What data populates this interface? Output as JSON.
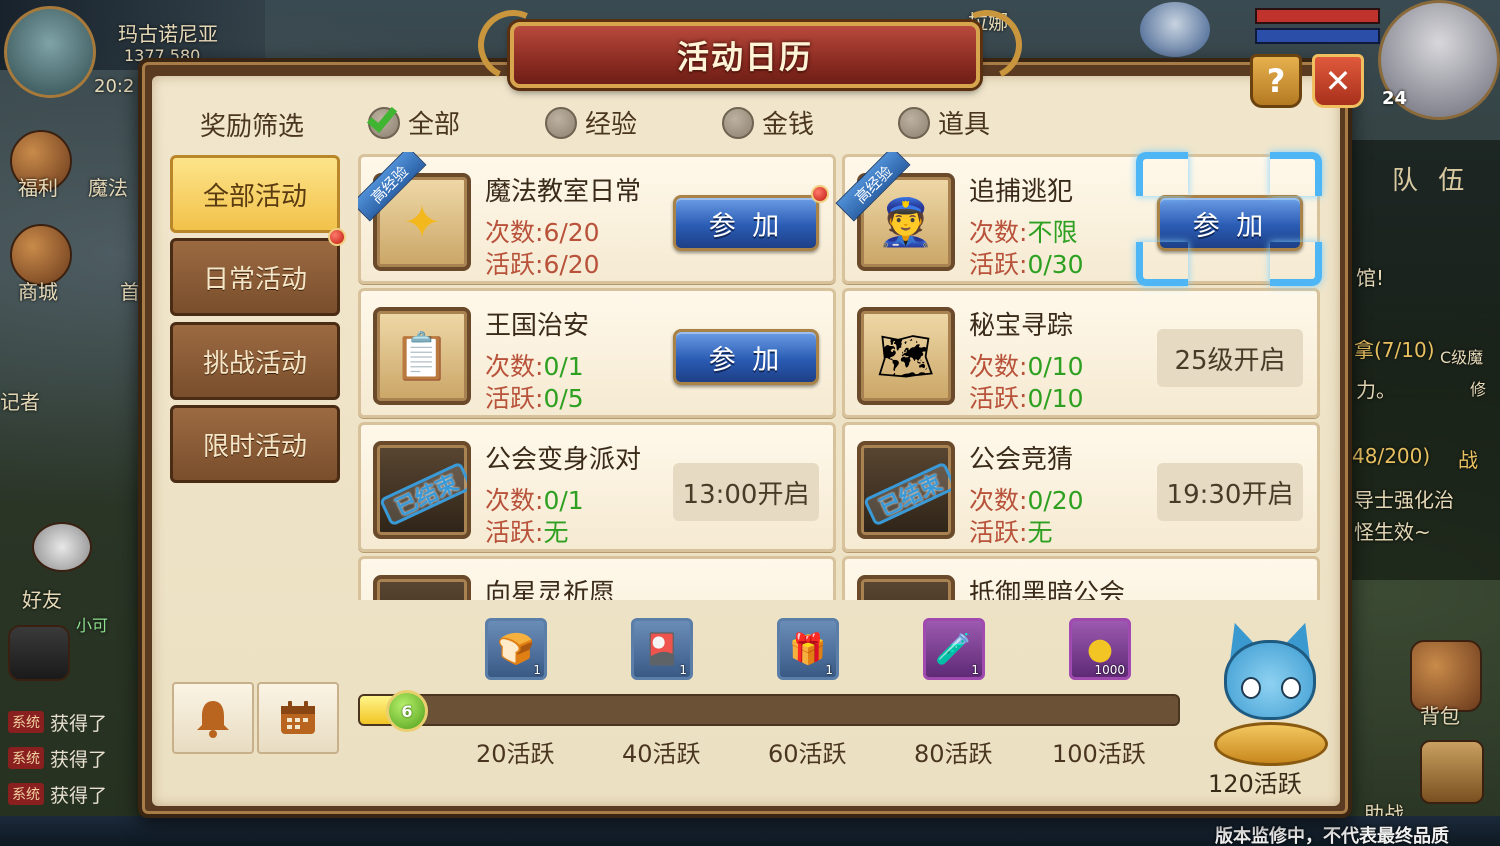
{
  "background": {
    "location_name": "玛古诺尼亚",
    "coords_partial": "1377,580",
    "time_partial": "20:2",
    "side_labels": [
      "福利",
      "魔法",
      "商城",
      "首",
      "记者",
      "好友",
      "小可"
    ],
    "npc_name": "拉娜",
    "player_level": "24",
    "team_label": "队 伍",
    "right_texts": [
      "馆!",
      "拿(7/10)",
      "C级魔",
      "力。",
      "修",
      "48/200)",
      "战",
      "导士强化治",
      "怪生效~"
    ],
    "bag_label": "背包",
    "fight_label": "助战",
    "chat": [
      {
        "badge": "系统",
        "text": "获得了"
      },
      {
        "badge": "系统",
        "text": "获得了"
      },
      {
        "badge": "系统",
        "text": "获得了"
      }
    ],
    "watermark": "版本监修中，不代表最终品质"
  },
  "dialog": {
    "title": "活动日历",
    "help_icon": "question-mark-icon",
    "close_icon": "close-x-icon"
  },
  "filter": {
    "label": "奖励筛选",
    "options": [
      {
        "label": "全部",
        "checked": true
      },
      {
        "label": "经验",
        "checked": false
      },
      {
        "label": "金钱",
        "checked": false
      },
      {
        "label": "道具",
        "checked": false
      }
    ]
  },
  "tabs": [
    {
      "label": "全部活动",
      "active": true,
      "dot": false
    },
    {
      "label": "日常活动",
      "active": false,
      "dot": true
    },
    {
      "label": "挑战活动",
      "active": false,
      "dot": false
    },
    {
      "label": "限时活动",
      "active": false,
      "dot": false
    }
  ],
  "activities": [
    {
      "name": "魔法教室日常",
      "ribbon": "高经验",
      "count_label": "次数:",
      "count": "6/20",
      "active_label": "活跃:",
      "active": "6/20",
      "action": "参 加",
      "icon": "magic-hand-icon",
      "dot": true
    },
    {
      "name": "追捕逃犯",
      "ribbon": "高经验",
      "count_label": "次数:",
      "count": "不限",
      "active_label": "活跃:",
      "active": "0/30",
      "action": "参 加",
      "icon": "wanted-poster-icon",
      "dot": false
    },
    {
      "name": "王国治安",
      "ribbon": "",
      "count_label": "次数:",
      "count": "0/1",
      "active_label": "活跃:",
      "active": "0/5",
      "action": "参 加",
      "icon": "notice-board-icon",
      "dot": false
    },
    {
      "name": "秘宝寻踪",
      "ribbon": "",
      "count_label": "次数:",
      "count": "0/10",
      "active_label": "活跃:",
      "active": "0/10",
      "status": "25级开启",
      "icon": "treasure-map-icon",
      "dot": false
    },
    {
      "name": "公会变身派对",
      "ribbon": "",
      "count_label": "次数:",
      "count": "0/1",
      "active_label": "活跃:",
      "active": "无",
      "status": "13:00开启",
      "stamp": "已结束",
      "icon": "guild-party-icon",
      "dot": false
    },
    {
      "name": "公会竞猜",
      "ribbon": "",
      "count_label": "次数:",
      "count": "0/20",
      "active_label": "活跃:",
      "active": "无",
      "status": "19:30开启",
      "stamp": "已结束",
      "icon": "guild-guess-icon",
      "dot": false
    },
    {
      "name": "向星灵祈愿",
      "ribbon": "",
      "count_label": "",
      "count": "",
      "active_label": "",
      "active": "",
      "icon": "star-spirit-icon",
      "dot": false
    },
    {
      "name": "抵御黑暗公会",
      "ribbon": "",
      "count_label": "",
      "count": "",
      "active_label": "",
      "active": "",
      "icon": "dark-guild-icon",
      "dot": false
    }
  ],
  "bottom_buttons": {
    "bell_icon": "bell-icon",
    "calendar_icon": "calendar-icon"
  },
  "rewards": [
    {
      "tier": "20活跃",
      "icon": "bread-icon",
      "count": "1",
      "rarity": "blue"
    },
    {
      "tier": "40活跃",
      "icon": "red-card-icon",
      "count": "1",
      "rarity": "blue"
    },
    {
      "tier": "60活跃",
      "icon": "gift-box-icon",
      "count": "1",
      "rarity": "blue"
    },
    {
      "tier": "80活跃",
      "icon": "green-potion-icon",
      "count": "1",
      "rarity": "purple"
    },
    {
      "tier": "100活跃",
      "icon": "gold-coin-icon",
      "count": "1000",
      "rarity": "purple"
    }
  ],
  "progress": {
    "current": "6",
    "fraction": 0.05
  },
  "final_reward": {
    "tier": "120活跃",
    "icon": "happy-cat-icon"
  }
}
